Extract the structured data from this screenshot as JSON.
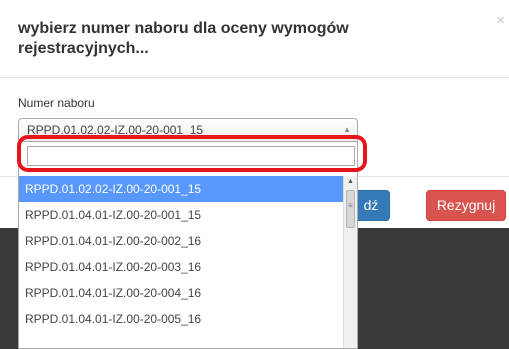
{
  "modal": {
    "title": "wybierz numer naboru dla oceny wymogów rejestracyjnych...",
    "close_label": "×"
  },
  "form": {
    "label": "Numer naboru",
    "selected_value": "RPPD.01.02.02-IZ.00-20-001_15",
    "search_value": "",
    "arrow_icon": "▲"
  },
  "dropdown": {
    "options": [
      "RPPD.01.02.02-IZ.00-20-001_15",
      "RPPD.01.04.01-IZ.00-20-001_15",
      "RPPD.01.04.01-IZ.00-20-002_16",
      "RPPD.01.04.01-IZ.00-20-003_16",
      "RPPD.01.04.01-IZ.00-20-004_16",
      "RPPD.01.04.01-IZ.00-20-005_16"
    ],
    "scroll_up_icon": "▲",
    "thumb_grip": "≡"
  },
  "buttons": {
    "confirm_label": "dź",
    "cancel_label": "Rezygnuj"
  },
  "colors": {
    "highlight": "#e8141b",
    "primary": "#337ab7",
    "danger": "#d9534f",
    "selected": "#5897fb"
  }
}
